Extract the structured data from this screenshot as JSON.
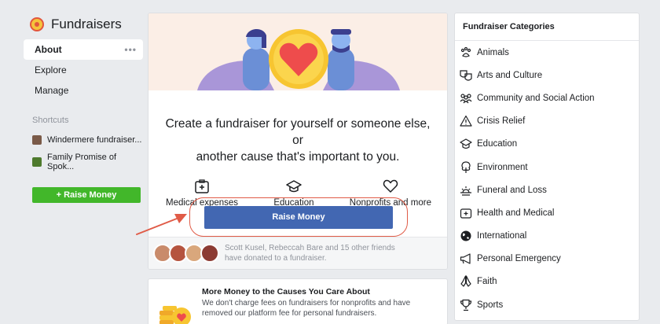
{
  "sidebar": {
    "title": "Fundraisers",
    "items": [
      {
        "label": "About",
        "more": "•••"
      },
      {
        "label": "Explore"
      },
      {
        "label": "Manage"
      }
    ],
    "shortcuts_label": "Shortcuts",
    "shortcuts": [
      {
        "label": "Windermere fundraiser...",
        "color": "#7a5a48"
      },
      {
        "label": "Family Promise of Spok...",
        "color": "#4e7a2d"
      }
    ],
    "raise_label": "+ Raise Money"
  },
  "center": {
    "headline_line1": "Create a fundraiser for yourself or someone else, or",
    "headline_line2": "another cause that's important to you.",
    "categories": [
      {
        "label": "Medical expenses",
        "icon": "medical-icon"
      },
      {
        "label": "Education",
        "icon": "education-icon"
      },
      {
        "label": "Nonprofits and more",
        "icon": "heart-icon"
      }
    ],
    "raise_label": "Raise Money",
    "friends_text": "Scott Kusel, Rebeccah Bare and 15 other friends have donated to a fundraiser."
  },
  "card2": {
    "title": "More Money to the Causes You Care About",
    "body": "We don't charge fees on fundraisers for nonprofits and have removed our platform fee for personal fundraisers."
  },
  "right": {
    "title": "Fundraiser Categories",
    "items": [
      {
        "label": "Animals",
        "icon": "paw-icon"
      },
      {
        "label": "Arts and Culture",
        "icon": "masks-icon"
      },
      {
        "label": "Community and Social Action",
        "icon": "people-icon"
      },
      {
        "label": "Crisis Relief",
        "icon": "warning-icon"
      },
      {
        "label": "Education",
        "icon": "graduation-cap-icon"
      },
      {
        "label": "Environment",
        "icon": "tree-icon"
      },
      {
        "label": "Funeral and Loss",
        "icon": "sunset-icon"
      },
      {
        "label": "Health and Medical",
        "icon": "medical-kit-icon"
      },
      {
        "label": "International",
        "icon": "globe-icon"
      },
      {
        "label": "Personal Emergency",
        "icon": "megaphone-icon"
      },
      {
        "label": "Faith",
        "icon": "praying-hands-icon"
      },
      {
        "label": "Sports",
        "icon": "trophy-icon"
      }
    ]
  },
  "colors": {
    "primary_button": "#4267b2",
    "green_button": "#42b72a",
    "highlight": "#e05b47"
  }
}
